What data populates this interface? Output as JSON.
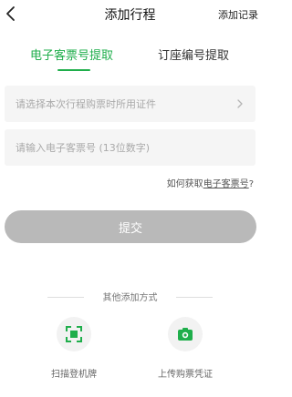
{
  "nav": {
    "title": "添加行程",
    "action": "添加记录"
  },
  "tabs": [
    {
      "label": "电子客票号提取",
      "active": true
    },
    {
      "label": "订座编号提取",
      "active": false
    }
  ],
  "form": {
    "certificate_placeholder": "请选择本次行程购票时所用证件",
    "ticket_placeholder": "请输入电子客票号 (13位数字)",
    "help_prefix": "如何获取",
    "help_link": "电子客票号",
    "help_suffix": "?",
    "submit_label": "提交"
  },
  "other": {
    "title": "其他添加方式",
    "methods": [
      {
        "label": "扫描登机牌",
        "icon": "scan-icon"
      },
      {
        "label": "上传购票凭证",
        "icon": "camera-icon"
      }
    ]
  },
  "colors": {
    "accent": "#1fae4b",
    "button_disabled": "#b9b9b9"
  }
}
